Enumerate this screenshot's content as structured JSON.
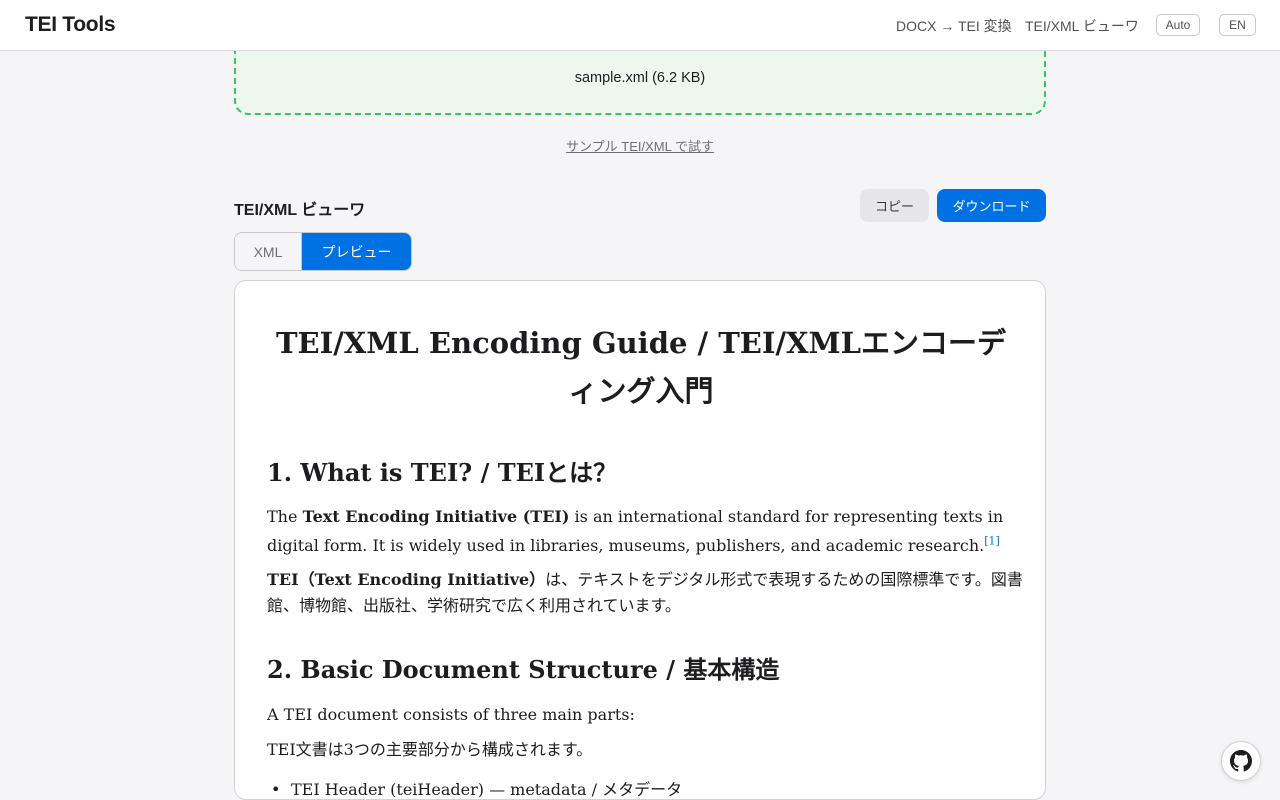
{
  "header": {
    "brand": "TEI Tools",
    "nav": {
      "docx": "DOCX → TEI 変換",
      "viewer": "TEI/XML ビューワ"
    },
    "theme_label": "Auto",
    "lang_label": "EN"
  },
  "upload": {
    "file_label": "sample.xml (6.2 KB)"
  },
  "sample_link": "サンプル TEI/XML で試す",
  "viewer": {
    "title": "TEI/XML ビューワ",
    "copy_label": "コピー",
    "download_label": "ダウンロード",
    "tabs": {
      "xml": "XML",
      "preview": "プレビュー"
    }
  },
  "document": {
    "title": "TEI/XML Encoding Guide / TEI/XMLエンコーディング入門",
    "h1": "1. What is TEI? / TEIとは？",
    "p1_pre": "The ",
    "p1_bold": "Text Encoding Initiative (TEI)",
    "p1_post": " is an international standard for representing texts in digital form. It is widely used in libraries, museums, publishers, and academic research.",
    "p1_fn": "[1]",
    "p2_bold": "TEI（Text Encoding Initiative）",
    "p2_post": "は、テキストをデジタル形式で表現するための国際標準です。図書館、博物館、出版社、学術研究で広く利用されています。",
    "h2": "2. Basic Document Structure / 基本構造",
    "p3": "A TEI document consists of three main parts:",
    "p4": "TEI文書は3つの主要部分から構成されます。",
    "bullet1": "TEI Header (teiHeader) — metadata / メタデータ"
  },
  "icons": {
    "github": "github-icon"
  }
}
